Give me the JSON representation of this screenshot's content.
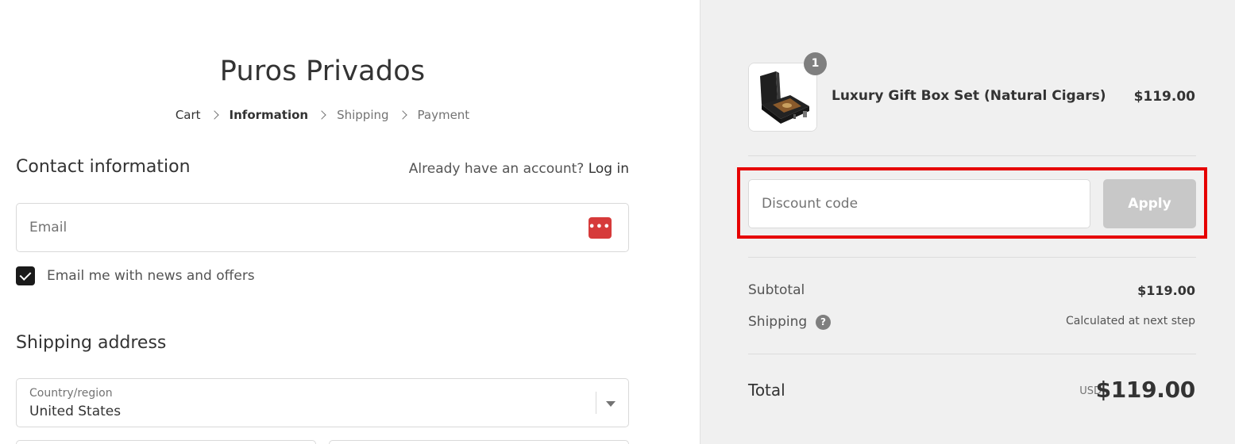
{
  "store": {
    "name": "Puros Privados"
  },
  "breadcrumbs": [
    {
      "label": "Cart"
    },
    {
      "label": "Information"
    },
    {
      "label": "Shipping"
    },
    {
      "label": "Payment"
    }
  ],
  "contact": {
    "title": "Contact information",
    "account_prompt": "Already have an account?",
    "login_label": "Log in",
    "email_placeholder": "Email",
    "email_value": "",
    "newsletter_label": "Email me with news and offers",
    "newsletter_checked": true
  },
  "shipping_address": {
    "title": "Shipping address",
    "country_label": "Country/region",
    "country_value": "United States"
  },
  "order": {
    "item": {
      "name": "Luxury Gift Box Set (Natural Cigars)",
      "price": "$119.00",
      "quantity": "1",
      "thumbnail_icon": "gift-box-image"
    },
    "discount": {
      "placeholder": "Discount code",
      "apply_label": "Apply"
    },
    "subtotal_label": "Subtotal",
    "subtotal_value": "$119.00",
    "shipping_label": "Shipping",
    "shipping_value": "Calculated at next step",
    "help_glyph": "?",
    "total_label": "Total",
    "currency": "USD",
    "total_value": "$119.00"
  },
  "colors": {
    "highlight": "#e60000",
    "sidebar_bg": "#f0f0f0",
    "apply_disabled": "#c8c8c8",
    "password_manager": "#d63a3a"
  }
}
